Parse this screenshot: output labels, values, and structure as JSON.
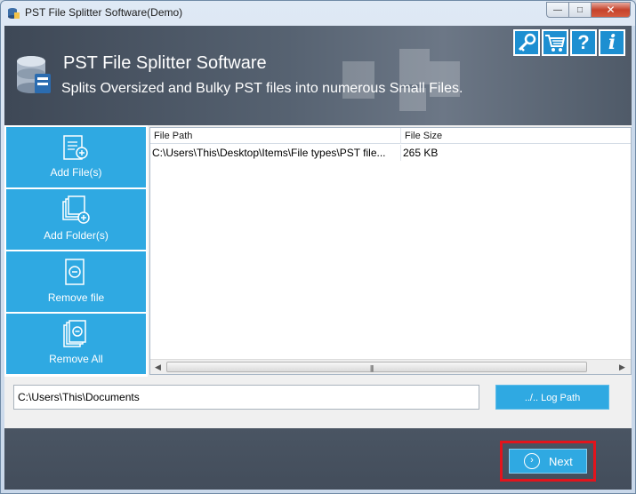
{
  "window": {
    "title": "PST File Splitter Software(Demo)",
    "controls": {
      "minimize": "—",
      "maximize": "□",
      "close": "✕"
    }
  },
  "header": {
    "title": "PST File Splitter Software",
    "subtitle": "Splits Oversized and Bulky PST files into numerous Small Files.",
    "buttons": [
      {
        "icon": "key-icon"
      },
      {
        "icon": "cart-icon"
      },
      {
        "icon": "help-icon",
        "label": "?"
      },
      {
        "icon": "info-icon",
        "label": "i"
      }
    ]
  },
  "sidebar": {
    "items": [
      {
        "label": "Add File(s)",
        "icon": "add-file-icon"
      },
      {
        "label": "Add Folder(s)",
        "icon": "add-folder-icon"
      },
      {
        "label": "Remove file",
        "icon": "remove-file-icon"
      },
      {
        "label": "Remove All",
        "icon": "remove-all-icon"
      }
    ]
  },
  "table": {
    "columns": [
      "File Path",
      "File Size"
    ],
    "rows": [
      [
        "C:\\Users\\This\\Desktop\\Items\\File types\\PST file...",
        "265 KB"
      ]
    ]
  },
  "output": {
    "path_value": "C:\\Users\\This\\Documents",
    "log_path_label": "../.. Log Path"
  },
  "footer": {
    "next_label": "Next",
    "next_icon": "›"
  },
  "colors": {
    "accent": "#2fa9e2",
    "header_dark": "#4a5563",
    "highlight": "#e3141c"
  }
}
